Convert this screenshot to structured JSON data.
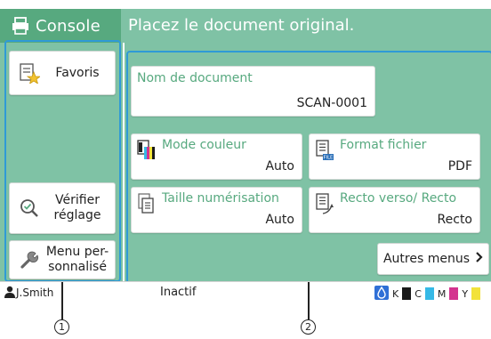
{
  "header": {
    "console_label": "Console",
    "message": "Placez le document original."
  },
  "left_menu": {
    "favoris_label": "Favoris",
    "verifier_line1": "Vérifier",
    "verifier_line2": "réglage",
    "menu_perso_line1": "Menu per-",
    "menu_perso_line2": "sonnalisé"
  },
  "document_name": {
    "title": "Nom de document",
    "value": "SCAN-0001"
  },
  "settings": [
    {
      "title": "Mode couleur",
      "value": "Auto",
      "icon": "color-mode-icon"
    },
    {
      "title": "Format fichier",
      "value": "PDF",
      "icon": "file-format-icon"
    },
    {
      "title": "Taille numérisation",
      "value": "Auto",
      "icon": "scan-size-icon"
    },
    {
      "title": "Recto verso/ Recto",
      "value": "Recto",
      "icon": "duplex-icon"
    }
  ],
  "more_menus_label": "Autres menus",
  "file_icon_label": "FILE",
  "status_bar": {
    "user": "J.Smith",
    "status": "Inactif",
    "toner": [
      {
        "label": "K",
        "color": "#1a1a1a"
      },
      {
        "label": "C",
        "color": "#36b9e6"
      },
      {
        "label": "M",
        "color": "#d4338f"
      },
      {
        "label": "Y",
        "color": "#f2e23a"
      }
    ]
  },
  "callouts": [
    "1",
    "2"
  ],
  "colors": {
    "accent_green": "#57a97f",
    "panel_green": "#7fc2a5",
    "highlight_blue": "#2f9ad6"
  }
}
